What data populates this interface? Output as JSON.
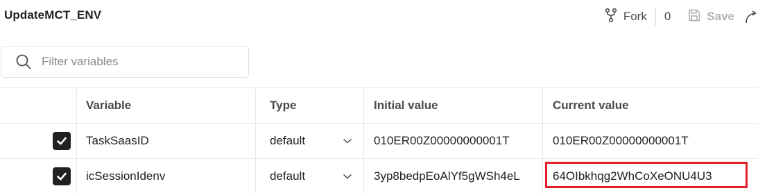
{
  "header": {
    "title": "UpdateMCT_ENV",
    "fork_label": "Fork",
    "fork_count": "0",
    "save_label": "Save"
  },
  "search": {
    "placeholder": "Filter variables",
    "value": ""
  },
  "table": {
    "columns": {
      "variable": "Variable",
      "type": "Type",
      "initial": "Initial value",
      "current": "Current value"
    },
    "rows": [
      {
        "enabled": true,
        "variable": "TaskSaasID",
        "type": "default",
        "initial": "010ER00Z00000000001T",
        "current": "010ER00Z00000000001T"
      },
      {
        "enabled": true,
        "variable": "icSessionIdenv",
        "type": "default",
        "initial": "3yp8bedpEoAlYf5gWSh4eL",
        "current": "64OIbkhqg2WhCoXeONU4U3"
      }
    ]
  },
  "annotation": {
    "highlight_color": "#e0212b",
    "highlighted_cell": "rows.1.current"
  },
  "icons": {
    "fork": "fork-icon",
    "save": "save-icon",
    "search": "search-icon",
    "check": "check-icon",
    "chevron": "chevron-down-icon"
  }
}
